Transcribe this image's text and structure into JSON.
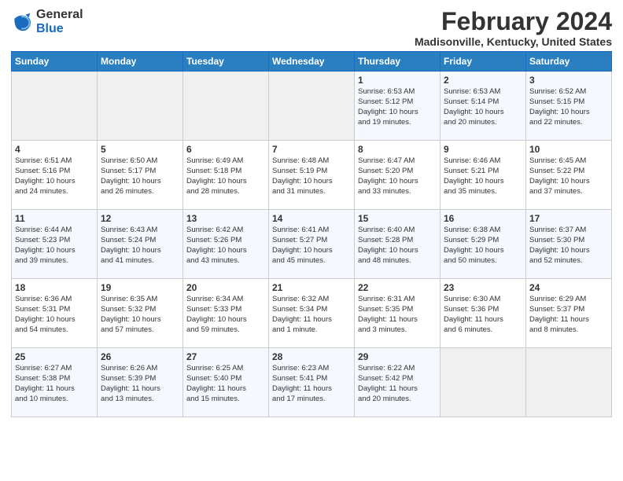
{
  "logo": {
    "general": "General",
    "blue": "Blue"
  },
  "title": "February 2024",
  "subtitle": "Madisonville, Kentucky, United States",
  "days_of_week": [
    "Sunday",
    "Monday",
    "Tuesday",
    "Wednesday",
    "Thursday",
    "Friday",
    "Saturday"
  ],
  "weeks": [
    [
      {
        "num": "",
        "info": ""
      },
      {
        "num": "",
        "info": ""
      },
      {
        "num": "",
        "info": ""
      },
      {
        "num": "",
        "info": ""
      },
      {
        "num": "1",
        "info": "Sunrise: 6:53 AM\nSunset: 5:12 PM\nDaylight: 10 hours\nand 19 minutes."
      },
      {
        "num": "2",
        "info": "Sunrise: 6:53 AM\nSunset: 5:14 PM\nDaylight: 10 hours\nand 20 minutes."
      },
      {
        "num": "3",
        "info": "Sunrise: 6:52 AM\nSunset: 5:15 PM\nDaylight: 10 hours\nand 22 minutes."
      }
    ],
    [
      {
        "num": "4",
        "info": "Sunrise: 6:51 AM\nSunset: 5:16 PM\nDaylight: 10 hours\nand 24 minutes."
      },
      {
        "num": "5",
        "info": "Sunrise: 6:50 AM\nSunset: 5:17 PM\nDaylight: 10 hours\nand 26 minutes."
      },
      {
        "num": "6",
        "info": "Sunrise: 6:49 AM\nSunset: 5:18 PM\nDaylight: 10 hours\nand 28 minutes."
      },
      {
        "num": "7",
        "info": "Sunrise: 6:48 AM\nSunset: 5:19 PM\nDaylight: 10 hours\nand 31 minutes."
      },
      {
        "num": "8",
        "info": "Sunrise: 6:47 AM\nSunset: 5:20 PM\nDaylight: 10 hours\nand 33 minutes."
      },
      {
        "num": "9",
        "info": "Sunrise: 6:46 AM\nSunset: 5:21 PM\nDaylight: 10 hours\nand 35 minutes."
      },
      {
        "num": "10",
        "info": "Sunrise: 6:45 AM\nSunset: 5:22 PM\nDaylight: 10 hours\nand 37 minutes."
      }
    ],
    [
      {
        "num": "11",
        "info": "Sunrise: 6:44 AM\nSunset: 5:23 PM\nDaylight: 10 hours\nand 39 minutes."
      },
      {
        "num": "12",
        "info": "Sunrise: 6:43 AM\nSunset: 5:24 PM\nDaylight: 10 hours\nand 41 minutes."
      },
      {
        "num": "13",
        "info": "Sunrise: 6:42 AM\nSunset: 5:26 PM\nDaylight: 10 hours\nand 43 minutes."
      },
      {
        "num": "14",
        "info": "Sunrise: 6:41 AM\nSunset: 5:27 PM\nDaylight: 10 hours\nand 45 minutes."
      },
      {
        "num": "15",
        "info": "Sunrise: 6:40 AM\nSunset: 5:28 PM\nDaylight: 10 hours\nand 48 minutes."
      },
      {
        "num": "16",
        "info": "Sunrise: 6:38 AM\nSunset: 5:29 PM\nDaylight: 10 hours\nand 50 minutes."
      },
      {
        "num": "17",
        "info": "Sunrise: 6:37 AM\nSunset: 5:30 PM\nDaylight: 10 hours\nand 52 minutes."
      }
    ],
    [
      {
        "num": "18",
        "info": "Sunrise: 6:36 AM\nSunset: 5:31 PM\nDaylight: 10 hours\nand 54 minutes."
      },
      {
        "num": "19",
        "info": "Sunrise: 6:35 AM\nSunset: 5:32 PM\nDaylight: 10 hours\nand 57 minutes."
      },
      {
        "num": "20",
        "info": "Sunrise: 6:34 AM\nSunset: 5:33 PM\nDaylight: 10 hours\nand 59 minutes."
      },
      {
        "num": "21",
        "info": "Sunrise: 6:32 AM\nSunset: 5:34 PM\nDaylight: 11 hours\nand 1 minute."
      },
      {
        "num": "22",
        "info": "Sunrise: 6:31 AM\nSunset: 5:35 PM\nDaylight: 11 hours\nand 3 minutes."
      },
      {
        "num": "23",
        "info": "Sunrise: 6:30 AM\nSunset: 5:36 PM\nDaylight: 11 hours\nand 6 minutes."
      },
      {
        "num": "24",
        "info": "Sunrise: 6:29 AM\nSunset: 5:37 PM\nDaylight: 11 hours\nand 8 minutes."
      }
    ],
    [
      {
        "num": "25",
        "info": "Sunrise: 6:27 AM\nSunset: 5:38 PM\nDaylight: 11 hours\nand 10 minutes."
      },
      {
        "num": "26",
        "info": "Sunrise: 6:26 AM\nSunset: 5:39 PM\nDaylight: 11 hours\nand 13 minutes."
      },
      {
        "num": "27",
        "info": "Sunrise: 6:25 AM\nSunset: 5:40 PM\nDaylight: 11 hours\nand 15 minutes."
      },
      {
        "num": "28",
        "info": "Sunrise: 6:23 AM\nSunset: 5:41 PM\nDaylight: 11 hours\nand 17 minutes."
      },
      {
        "num": "29",
        "info": "Sunrise: 6:22 AM\nSunset: 5:42 PM\nDaylight: 11 hours\nand 20 minutes."
      },
      {
        "num": "",
        "info": ""
      },
      {
        "num": "",
        "info": ""
      }
    ]
  ]
}
